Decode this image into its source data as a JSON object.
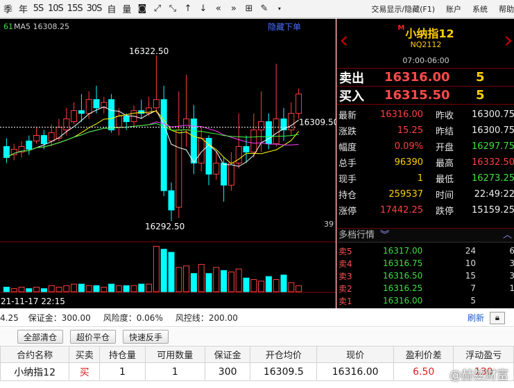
{
  "toolbar": {
    "buttons": [
      "季",
      "年",
      "5S",
      "10S",
      "15S",
      "30S",
      "自",
      "量"
    ],
    "menu": [
      "交易显示/隐藏(F1)",
      "账户",
      "系统",
      "帮助"
    ]
  },
  "chart": {
    "ma_prefix": "61",
    "ma_label": "MA5 16308.25",
    "hide_order": "隐藏下单",
    "high_label": "16322.50",
    "low_label": "16292.50",
    "price_tag": "16309.50",
    "vol_label": "39",
    "date_label": "21-11-17 22:15"
  },
  "chart_data": {
    "type": "candlestick",
    "ma_value": 16308.25,
    "high": 16322.5,
    "low": 16292.5,
    "last_marker": 16309.5,
    "candles": [
      {
        "o": 16306.0,
        "c": 16304.0,
        "h": 16307.5,
        "l": 16303.0
      },
      {
        "o": 16304.5,
        "c": 16305.5,
        "h": 16306.5,
        "l": 16303.5
      },
      {
        "o": 16305.0,
        "c": 16306.0,
        "h": 16307.0,
        "l": 16304.0
      },
      {
        "o": 16307.0,
        "c": 16305.5,
        "h": 16308.0,
        "l": 16304.5
      },
      {
        "o": 16307.0,
        "c": 16308.0,
        "h": 16309.5,
        "l": 16306.5
      },
      {
        "o": 16308.0,
        "c": 16306.5,
        "h": 16309.0,
        "l": 16305.5
      },
      {
        "o": 16307.0,
        "c": 16308.5,
        "h": 16310.0,
        "l": 16306.0
      },
      {
        "o": 16307.5,
        "c": 16309.5,
        "h": 16311.0,
        "l": 16307.0
      },
      {
        "o": 16309.0,
        "c": 16311.0,
        "h": 16313.0,
        "l": 16308.0
      },
      {
        "o": 16310.5,
        "c": 16312.5,
        "h": 16314.0,
        "l": 16310.0
      },
      {
        "o": 16312.5,
        "c": 16312.0,
        "h": 16315.5,
        "l": 16310.5
      },
      {
        "o": 16312.0,
        "c": 16314.5,
        "h": 16316.0,
        "l": 16311.0
      },
      {
        "o": 16314.5,
        "c": 16313.0,
        "h": 16317.0,
        "l": 16312.0
      },
      {
        "o": 16313.0,
        "c": 16314.0,
        "h": 16315.0,
        "l": 16312.0
      },
      {
        "o": 16314.5,
        "c": 16309.0,
        "h": 16315.5,
        "l": 16308.5
      },
      {
        "o": 16309.5,
        "c": 16311.5,
        "h": 16313.0,
        "l": 16308.0
      },
      {
        "o": 16311.5,
        "c": 16310.5,
        "h": 16312.0,
        "l": 16309.0
      },
      {
        "o": 16310.5,
        "c": 16312.5,
        "h": 16313.5,
        "l": 16309.5
      },
      {
        "o": 16312.5,
        "c": 16312.0,
        "h": 16314.5,
        "l": 16311.0
      },
      {
        "o": 16312.0,
        "c": 16313.0,
        "h": 16315.0,
        "l": 16311.5
      },
      {
        "o": 16313.0,
        "c": 16314.5,
        "h": 16322.5,
        "l": 16312.0
      },
      {
        "o": 16314.5,
        "c": 16298.0,
        "h": 16317.0,
        "l": 16297.0
      },
      {
        "o": 16298.0,
        "c": 16294.5,
        "h": 16299.5,
        "l": 16292.5
      },
      {
        "o": 16295.0,
        "c": 16309.0,
        "h": 16316.0,
        "l": 16293.0
      },
      {
        "o": 16309.0,
        "c": 16311.0,
        "h": 16319.0,
        "l": 16306.0
      },
      {
        "o": 16311.0,
        "c": 16303.0,
        "h": 16313.5,
        "l": 16301.0
      },
      {
        "o": 16303.0,
        "c": 16307.5,
        "h": 16309.5,
        "l": 16301.5
      },
      {
        "o": 16307.5,
        "c": 16301.0,
        "h": 16308.0,
        "l": 16299.0
      },
      {
        "o": 16301.0,
        "c": 16303.0,
        "h": 16305.0,
        "l": 16300.0
      },
      {
        "o": 16303.0,
        "c": 16299.0,
        "h": 16304.0,
        "l": 16296.0
      },
      {
        "o": 16299.0,
        "c": 16303.0,
        "h": 16305.0,
        "l": 16298.0
      },
      {
        "o": 16303.0,
        "c": 16306.0,
        "h": 16312.0,
        "l": 16302.0
      },
      {
        "o": 16306.0,
        "c": 16305.0,
        "h": 16308.0,
        "l": 16303.0
      },
      {
        "o": 16305.0,
        "c": 16309.0,
        "h": 16312.0,
        "l": 16304.0
      },
      {
        "o": 16309.0,
        "c": 16310.5,
        "h": 16316.0,
        "l": 16305.0
      },
      {
        "o": 16310.5,
        "c": 16306.5,
        "h": 16312.0,
        "l": 16305.5
      },
      {
        "o": 16306.5,
        "c": 16311.0,
        "h": 16321.0,
        "l": 16306.0
      },
      {
        "o": 16311.0,
        "c": 16309.0,
        "h": 16313.0,
        "l": 16307.0
      },
      {
        "o": 16309.0,
        "c": 16312.0,
        "h": 16314.0,
        "l": 16308.0
      },
      {
        "o": 16312.0,
        "c": 16315.5,
        "h": 16316.5,
        "l": 16311.0
      }
    ],
    "volumes": [
      3,
      2,
      3,
      2,
      3,
      2,
      4,
      3,
      4,
      5,
      5,
      4,
      4,
      3,
      5,
      4,
      4,
      4,
      5,
      5,
      30,
      28,
      26,
      16,
      17,
      12,
      18,
      12,
      16,
      14,
      13,
      15,
      9,
      8,
      7,
      10,
      8,
      11,
      6,
      4
    ]
  },
  "quote": {
    "name_prefix": "M",
    "name": "小纳指12",
    "code": "NQ2112",
    "session": "07:00-06:00",
    "sell_label": "卖出",
    "sell_price": "16316.00",
    "sell_qty": "5",
    "buy_label": "买入",
    "buy_price": "16315.50",
    "buy_qty": "5",
    "rows": [
      {
        "k": "最新",
        "v": "16316.00",
        "vc": "red",
        "k2": "昨收",
        "v2": "16300.75",
        "v2c": "white"
      },
      {
        "k": "涨跌",
        "v": "15.25",
        "vc": "red",
        "k2": "昨结",
        "v2": "16300.75",
        "v2c": "white"
      },
      {
        "k": "幅度",
        "v": "0.09%",
        "vc": "red",
        "k2": "开盘",
        "v2": "16297.75",
        "v2c": "green"
      },
      {
        "k": "总手",
        "v": "96390",
        "vc": "yellow",
        "k2": "最高",
        "v2": "16332.50",
        "v2c": "red"
      },
      {
        "k": "现手",
        "v": "1",
        "vc": "yellow",
        "k2": "最低",
        "v2": "16273.25",
        "v2c": "green"
      },
      {
        "k": "持仓",
        "v": "259537",
        "vc": "yellow",
        "k2": "时间",
        "v2": "22:49:22",
        "v2c": "white"
      },
      {
        "k": "涨停",
        "v": "17442.25",
        "vc": "red",
        "k2": "跌停",
        "v2": "15159.25",
        "v2c": "white"
      }
    ]
  },
  "depth": {
    "title": "多档行情",
    "rows": [
      {
        "name": "卖5",
        "price": "16317.00",
        "qty": "24",
        "extra": "6"
      },
      {
        "name": "卖4",
        "price": "16316.75",
        "qty": "10",
        "extra": "3"
      },
      {
        "name": "卖3",
        "price": "16316.50",
        "qty": "15",
        "extra": "3"
      },
      {
        "name": "卖2",
        "price": "16316.25",
        "qty": "7",
        "extra": "1"
      },
      {
        "name": "卖1",
        "price": "16316.00",
        "qty": "5",
        "extra": ""
      }
    ]
  },
  "status": {
    "lead": "4.25",
    "margin": "保证金：300.00",
    "risk": "风险度：0.06%",
    "risk_line": "风控线：200.00",
    "refresh": "刷新"
  },
  "actions": [
    "全部清仓",
    "超价平仓",
    "快速反手"
  ],
  "positions": {
    "headers": [
      "合约名称",
      "买卖",
      "持仓量",
      "可用数量",
      "保证金",
      "开仓均价",
      "现价",
      "盈利价差",
      "浮动盈亏"
    ],
    "rows": [
      {
        "name": "小纳指12",
        "side": "买",
        "qty": "1",
        "avail": "1",
        "margin": "300",
        "open": "16309.5",
        "now": "16316.00",
        "spread": "6.50",
        "pnl": "130"
      }
    ]
  },
  "watermark": "@赫兹财富",
  "colors": {
    "up": "#ff4040",
    "down": "#00ffff",
    "ma5": "#ffffff",
    "ma10": "#ffff00",
    "ma20": "#ff40ff",
    "ma60": "#40ff40"
  }
}
